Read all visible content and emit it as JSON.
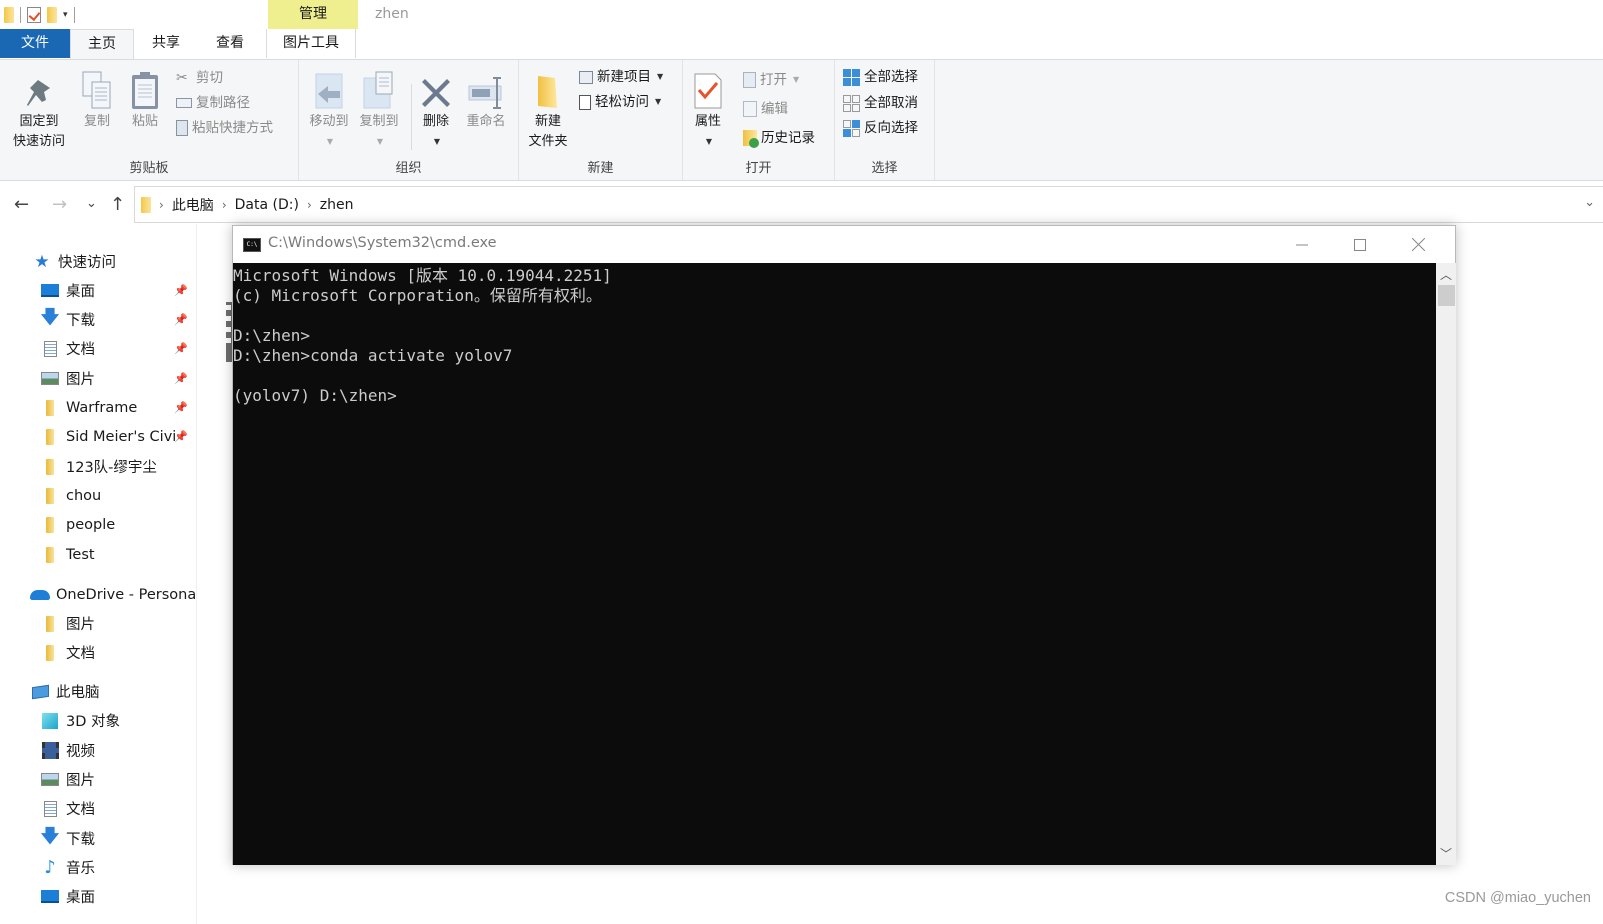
{
  "titlebar": {
    "context_tab": "管理",
    "window_title": "zhen",
    "qat_dropdown": "▾"
  },
  "ribbon_tabs": [
    {
      "label": "文件"
    },
    {
      "label": "主页"
    },
    {
      "label": "共享"
    },
    {
      "label": "查看"
    },
    {
      "label": "图片工具"
    }
  ],
  "ribbon": {
    "clipboard": {
      "label": "剪贴板",
      "pin_line1": "固定到",
      "pin_line2": "快速访问",
      "copy": "复制",
      "paste": "粘贴",
      "cut": "剪切",
      "copy_path": "复制路径",
      "paste_shortcut": "粘贴快捷方式"
    },
    "organize": {
      "label": "组织",
      "move_to": "移动到",
      "copy_to": "复制到",
      "delete": "删除",
      "rename": "重命名"
    },
    "new": {
      "label": "新建",
      "new_folder_line1": "新建",
      "new_folder_line2": "文件夹",
      "new_item": "新建项目",
      "easy_access": "轻松访问"
    },
    "open": {
      "label": "打开",
      "properties": "属性",
      "open": "打开",
      "edit": "编辑",
      "history": "历史记录"
    },
    "select": {
      "label": "选择",
      "select_all": "全部选择",
      "select_none": "全部取消",
      "invert": "反向选择"
    }
  },
  "navigation": {
    "back": "←",
    "forward": "→",
    "recent": "⌄",
    "up": "↑",
    "breadcrumb": [
      "此电脑",
      "Data (D:)",
      "zhen"
    ],
    "separator": "›"
  },
  "sidebar": {
    "quick_access": {
      "label": "快速访问",
      "items": [
        {
          "label": "桌面",
          "icon": "desktop-icon",
          "pinned": true
        },
        {
          "label": "下载",
          "icon": "download-icon",
          "pinned": true
        },
        {
          "label": "文档",
          "icon": "document-icon",
          "pinned": true
        },
        {
          "label": "图片",
          "icon": "picture-icon",
          "pinned": true
        },
        {
          "label": "Warframe",
          "icon": "folder-icon",
          "pinned": true
        },
        {
          "label": "Sid Meier's Civi",
          "icon": "folder-icon",
          "pinned": true
        },
        {
          "label": "123队-缪宇尘",
          "icon": "folder-icon",
          "pinned": false
        },
        {
          "label": "chou",
          "icon": "folder-icon",
          "pinned": false
        },
        {
          "label": "people",
          "icon": "folder-icon",
          "pinned": false
        },
        {
          "label": "Test",
          "icon": "folder-icon",
          "pinned": false
        }
      ]
    },
    "onedrive": {
      "label": "OneDrive - Persona",
      "items": [
        {
          "label": "图片",
          "icon": "folder-icon"
        },
        {
          "label": "文档",
          "icon": "folder-icon"
        }
      ]
    },
    "this_pc": {
      "label": "此电脑",
      "items": [
        {
          "label": "3D 对象",
          "icon": "3d-objects-icon"
        },
        {
          "label": "视频",
          "icon": "video-icon"
        },
        {
          "label": "图片",
          "icon": "picture-icon"
        },
        {
          "label": "文档",
          "icon": "document-icon"
        },
        {
          "label": "下载",
          "icon": "download-icon"
        },
        {
          "label": "音乐",
          "icon": "music-icon"
        },
        {
          "label": "桌面",
          "icon": "desktop-icon"
        }
      ]
    },
    "pin_glyph": "📌"
  },
  "cmd": {
    "title": "C:\\Windows\\System32\\cmd.exe",
    "icon_text": "C:\\",
    "lines": [
      "Microsoft Windows [版本 10.0.19044.2251]",
      "(c) Microsoft Corporation。保留所有权利。",
      "",
      "D:\\zhen>",
      "D:\\zhen>conda activate yolov7",
      "",
      "(yolov7) D:\\zhen>"
    ]
  },
  "watermark": "CSDN @miao_yuchen"
}
